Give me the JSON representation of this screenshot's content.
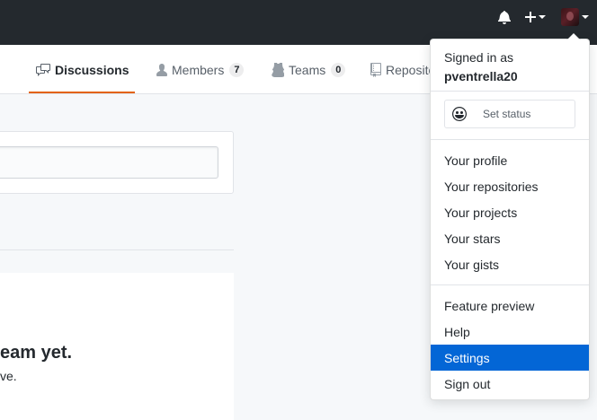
{
  "header": {
    "notifications_icon": "bell-icon",
    "create_icon": "plus-icon",
    "avatar_icon": "avatar"
  },
  "tabs": [
    {
      "label": "Discussions",
      "icon": "comment-discussion-icon",
      "selected": true
    },
    {
      "label": "Members",
      "icon": "person-icon",
      "count": "7"
    },
    {
      "label": "Teams",
      "icon": "jersey-icon",
      "count": "0"
    },
    {
      "label": "Reposito",
      "icon": "repo-icon"
    }
  ],
  "main": {
    "blank_title": "eam yet.",
    "blank_text": "ve."
  },
  "dropdown": {
    "signed_in_label": "Signed in as",
    "username": "pventrella20",
    "set_status_label": "Set status",
    "set_status_icon": "smiley-icon",
    "items": [
      {
        "label": "Your profile"
      },
      {
        "label": "Your repositories"
      },
      {
        "label": "Your projects"
      },
      {
        "label": "Your stars"
      },
      {
        "label": "Your gists"
      },
      {
        "label": "Feature preview"
      },
      {
        "label": "Help"
      },
      {
        "label": "Settings",
        "active": true
      },
      {
        "label": "Sign out"
      }
    ]
  },
  "colors": {
    "header_bg": "#24292e",
    "tab_underline": "#e36209",
    "active_item_bg": "#0366d6"
  }
}
